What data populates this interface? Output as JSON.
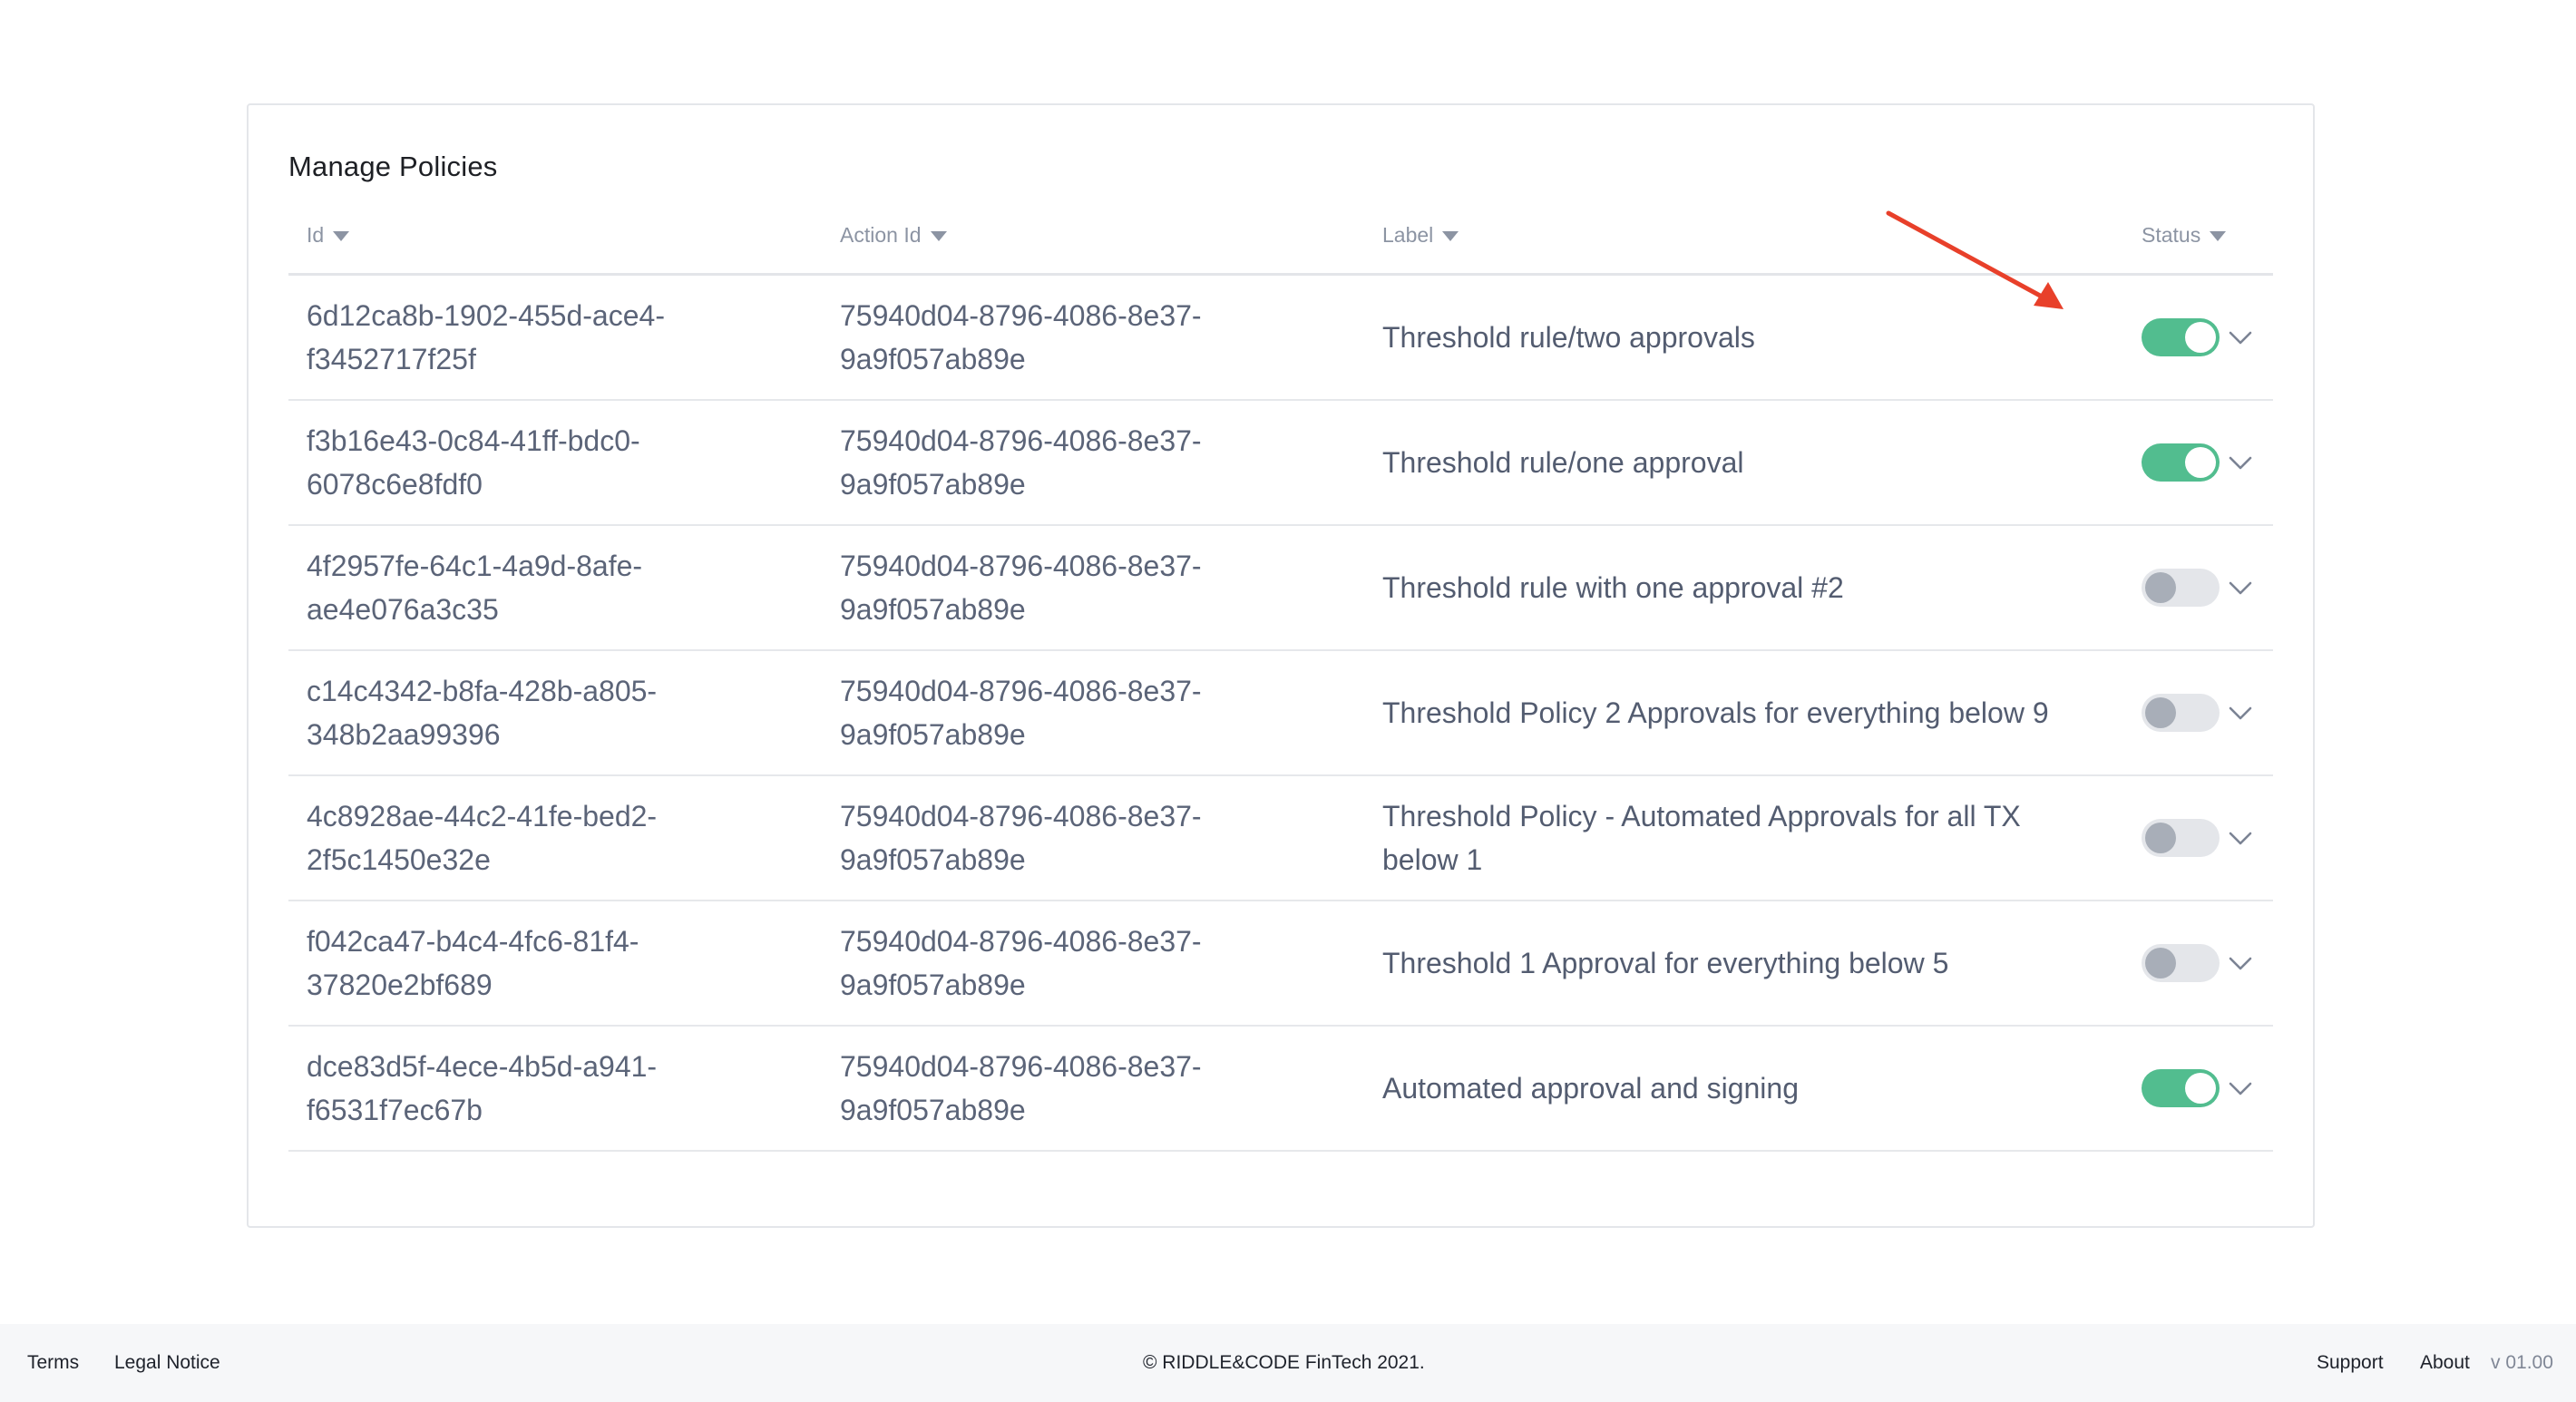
{
  "card": {
    "title": "Manage Policies"
  },
  "table": {
    "columns": [
      {
        "key": "id",
        "label": "Id"
      },
      {
        "key": "action_id",
        "label": "Action Id"
      },
      {
        "key": "label",
        "label": "Label"
      },
      {
        "key": "status",
        "label": "Status"
      }
    ],
    "rows": [
      {
        "id": "6d12ca8b-1902-455d-ace4-f3452717f25f",
        "action_id": "75940d04-8796-4086-8e37-9a9f057ab89e",
        "label": "Threshold rule/two approvals",
        "status_on": true
      },
      {
        "id": "f3b16e43-0c84-41ff-bdc0-6078c6e8fdf0",
        "action_id": "75940d04-8796-4086-8e37-9a9f057ab89e",
        "label": "Threshold rule/one approval",
        "status_on": true
      },
      {
        "id": "4f2957fe-64c1-4a9d-8afe-ae4e076a3c35",
        "action_id": "75940d04-8796-4086-8e37-9a9f057ab89e",
        "label": "Threshold rule with one approval #2",
        "status_on": false
      },
      {
        "id": "c14c4342-b8fa-428b-a805-348b2aa99396",
        "action_id": "75940d04-8796-4086-8e37-9a9f057ab89e",
        "label": "Threshold Policy 2 Approvals for everything below 9",
        "status_on": false
      },
      {
        "id": "4c8928ae-44c2-41fe-bed2-2f5c1450e32e",
        "action_id": "75940d04-8796-4086-8e37-9a9f057ab89e",
        "label": "Threshold Policy - Automated Approvals for all TX below 1",
        "status_on": false
      },
      {
        "id": "f042ca47-b4c4-4fc6-81f4-37820e2bf689",
        "action_id": "75940d04-8796-4086-8e37-9a9f057ab89e",
        "label": "Threshold 1 Approval for everything below 5",
        "status_on": false
      },
      {
        "id": "dce83d5f-4ece-4b5d-a941-f6531f7ec67b",
        "action_id": "75940d04-8796-4086-8e37-9a9f057ab89e",
        "label": "Automated approval and signing",
        "status_on": true
      }
    ]
  },
  "colors": {
    "toggle_on": "#52bd8f",
    "toggle_off": "#e4e6ea",
    "annotation_arrow": "#e8402a"
  },
  "icons": {
    "sort": "caret-down-icon",
    "expand": "chevron-down-icon",
    "annotation": "arrow-annotation-icon"
  },
  "footer": {
    "terms": "Terms",
    "legal_notice": "Legal Notice",
    "copyright": "© RIDDLE&CODE FinTech 2021.",
    "support": "Support",
    "about": "About",
    "version": "v 01.00"
  }
}
